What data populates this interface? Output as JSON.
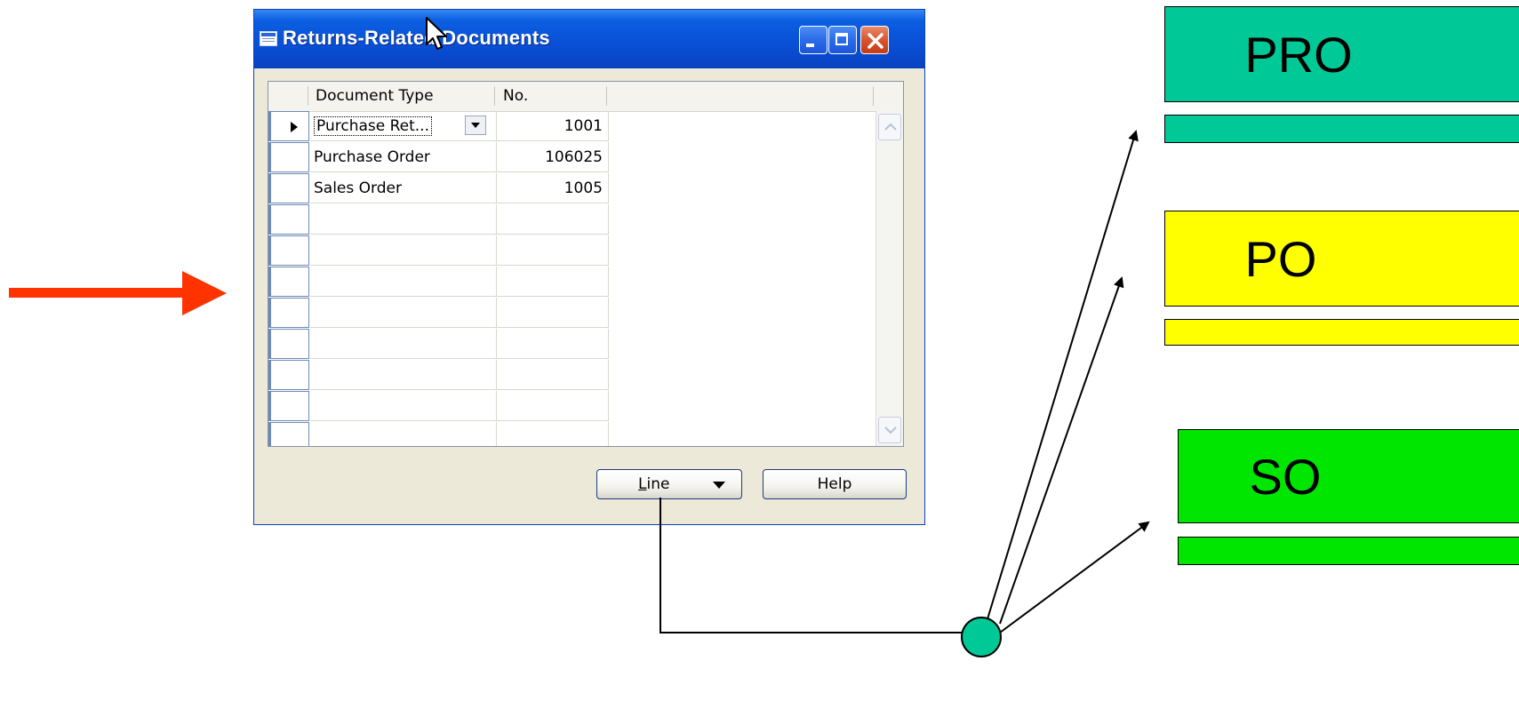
{
  "window": {
    "title": "Returns-Related Documents"
  },
  "grid": {
    "columns": [
      "Document Type",
      "No."
    ],
    "rows": [
      {
        "document_type": "Purchase Ret...",
        "no": "1001"
      },
      {
        "document_type": "Purchase Order",
        "no": "106025"
      },
      {
        "document_type": "Sales Order",
        "no": "1005"
      }
    ]
  },
  "buttons": {
    "line": "Line",
    "help": "Help"
  },
  "doc_boxes": [
    {
      "label": "PRO",
      "color": "#00c896"
    },
    {
      "label": "PO",
      "color": "#ffff00"
    },
    {
      "label": "SO",
      "color": "#00e600"
    }
  ],
  "colors": {
    "arrow": "#ff3300",
    "node": "#00c896"
  }
}
